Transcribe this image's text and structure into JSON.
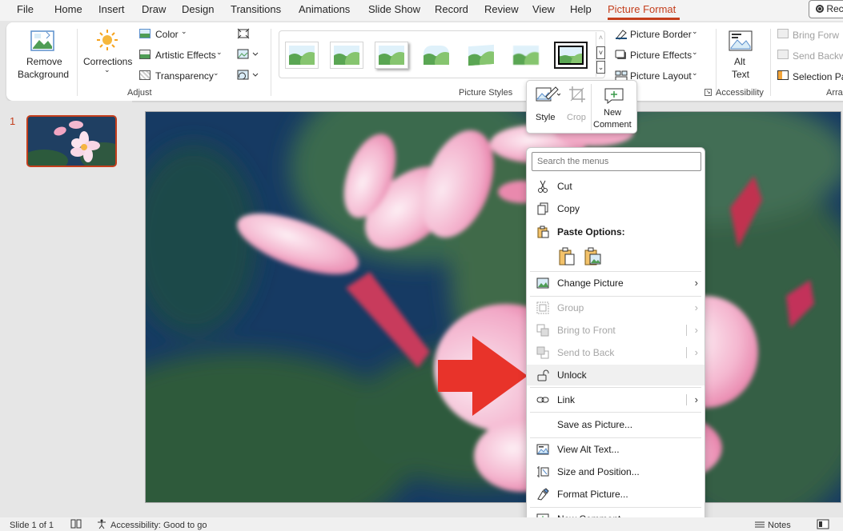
{
  "tabs": [
    "File",
    "Home",
    "Insert",
    "Draw",
    "Design",
    "Transitions",
    "Animations",
    "Slide Show",
    "Record",
    "Review",
    "View",
    "Help",
    "Picture Format"
  ],
  "active_tab": "Picture Format",
  "record_button": "Rec",
  "ribbon": {
    "remove_background": [
      "Remove",
      "Background"
    ],
    "corrections": "Corrections",
    "color": "Color",
    "artistic_effects": "Artistic Effects",
    "transparency": "Transparency",
    "adjust_group": "Adjust",
    "picture_styles_group": "Picture Styles",
    "picture_border": "Picture Border",
    "picture_effects": "Picture Effects",
    "picture_layout": "Picture Layout",
    "alt_text": [
      "Alt",
      "Text"
    ],
    "accessibility_group": "Accessibility",
    "bring_forward": "Bring Forw",
    "send_backward": "Send Backw",
    "selection_pane": "Selection Pa",
    "arrange_group": "Arra"
  },
  "slide_pane": {
    "slide_number": "1"
  },
  "mini_toolbar": {
    "style": "Style",
    "crop": "Crop",
    "new_comment": [
      "New",
      "Comment"
    ]
  },
  "context_menu": {
    "search_placeholder": "Search the menus",
    "items": {
      "cut": "Cut",
      "copy": "Copy",
      "paste_options": "Paste Options:",
      "change_picture": "Change Picture",
      "group": "Group",
      "bring_to_front": "Bring to Front",
      "send_to_back": "Send to Back",
      "unlock": "Unlock",
      "link": "Link",
      "save_as_picture": "Save as Picture...",
      "view_alt_text": "View Alt Text...",
      "size_and_position": "Size and Position...",
      "format_picture": "Format Picture...",
      "new_comment": "New Comment"
    }
  },
  "status_bar": {
    "slide_counter": "Slide 1 of 1",
    "accessibility": "Accessibility: Good to go",
    "notes": "Notes"
  },
  "colors": {
    "accent": "#c43e1c",
    "arrow": "#e8332a"
  }
}
